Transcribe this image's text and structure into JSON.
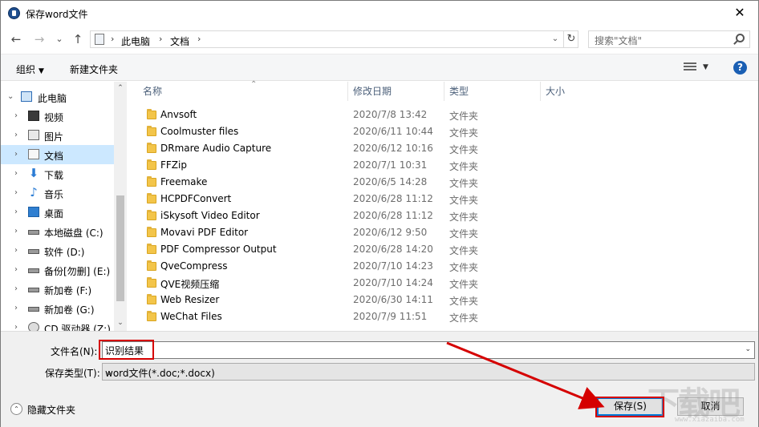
{
  "window": {
    "title": "保存word文件",
    "close_glyph": "✕"
  },
  "navigation": {
    "back_glyph": "←",
    "forward_glyph": "→",
    "recent_glyph": "⌄",
    "up_glyph": "↑",
    "breadcrumb": [
      "此电脑",
      "文档"
    ],
    "breadcrumb_sep": "›",
    "dropdown_glyph": "⌄",
    "refresh_glyph": "↻",
    "search_placeholder": "搜索\"文档\""
  },
  "toolbar": {
    "organize_label": "组织",
    "organize_caret": "▼",
    "new_folder_label": "新建文件夹",
    "view_caret": "▼",
    "help_glyph": "?"
  },
  "sidebar": {
    "items": [
      {
        "label": "此电脑",
        "icon": "pc-icon",
        "expanded": true
      },
      {
        "label": "视频",
        "icon": "video-icon"
      },
      {
        "label": "图片",
        "icon": "picture-icon"
      },
      {
        "label": "文档",
        "icon": "document-icon",
        "selected": true
      },
      {
        "label": "下载",
        "icon": "download-icon"
      },
      {
        "label": "音乐",
        "icon": "music-icon"
      },
      {
        "label": "桌面",
        "icon": "desktop-icon"
      },
      {
        "label": "本地磁盘 (C:)",
        "icon": "system-drive-icon"
      },
      {
        "label": "软件 (D:)",
        "icon": "drive-icon"
      },
      {
        "label": "备份[勿删] (E:)",
        "icon": "drive-icon"
      },
      {
        "label": "新加卷 (F:)",
        "icon": "drive-icon"
      },
      {
        "label": "新加卷 (G:)",
        "icon": "drive-icon"
      },
      {
        "label": "CD 驱动器 (Z:)",
        "icon": "cd-drive-icon"
      }
    ],
    "expand_glyph": "›",
    "expanded_glyph": "⌄",
    "scroll_up_glyph": "⌃",
    "scroll_down_glyph": "⌄"
  },
  "file_list": {
    "columns": [
      "名称",
      "修改日期",
      "类型",
      "大小"
    ],
    "sort_glyph": "⌃",
    "rows": [
      {
        "name": "Anvsoft",
        "date": "2020/7/8 13:42",
        "type": "文件夹"
      },
      {
        "name": "Coolmuster files",
        "date": "2020/6/11 10:44",
        "type": "文件夹"
      },
      {
        "name": "DRmare Audio Capture",
        "date": "2020/6/12 10:16",
        "type": "文件夹"
      },
      {
        "name": "FFZip",
        "date": "2020/7/1 10:31",
        "type": "文件夹"
      },
      {
        "name": "Freemake",
        "date": "2020/6/5 14:28",
        "type": "文件夹"
      },
      {
        "name": "HCPDFConvert",
        "date": "2020/6/28 11:12",
        "type": "文件夹"
      },
      {
        "name": "iSkysoft Video Editor",
        "date": "2020/6/28 11:12",
        "type": "文件夹"
      },
      {
        "name": "Movavi PDF Editor",
        "date": "2020/6/12 9:50",
        "type": "文件夹"
      },
      {
        "name": "PDF Compressor Output",
        "date": "2020/6/28 14:20",
        "type": "文件夹"
      },
      {
        "name": "QveCompress",
        "date": "2020/7/10 14:23",
        "type": "文件夹"
      },
      {
        "name": "QVE视频压缩",
        "date": "2020/7/10 14:24",
        "type": "文件夹"
      },
      {
        "name": "Web Resizer",
        "date": "2020/6/30 14:11",
        "type": "文件夹"
      },
      {
        "name": "WeChat Files",
        "date": "2020/7/9 11:51",
        "type": "文件夹"
      }
    ]
  },
  "footer": {
    "filename_label": "文件名(N):",
    "filename_value": "识别结果",
    "filetype_label": "保存类型(T):",
    "filetype_value": "word文件(*.doc;*.docx)",
    "dropdown_glyph": "⌄",
    "hide_folders_label": "隐藏文件夹",
    "hide_folders_glyph": "⌃",
    "save_label": "保存(S)",
    "cancel_label": "取消"
  },
  "watermark": {
    "big": "下载吧",
    "small": "www.xiazaiba.com"
  },
  "colors": {
    "accent": "#0078d7",
    "annotation": "#d50000",
    "selection": "#cce8ff",
    "folder": "#f3c54a"
  }
}
